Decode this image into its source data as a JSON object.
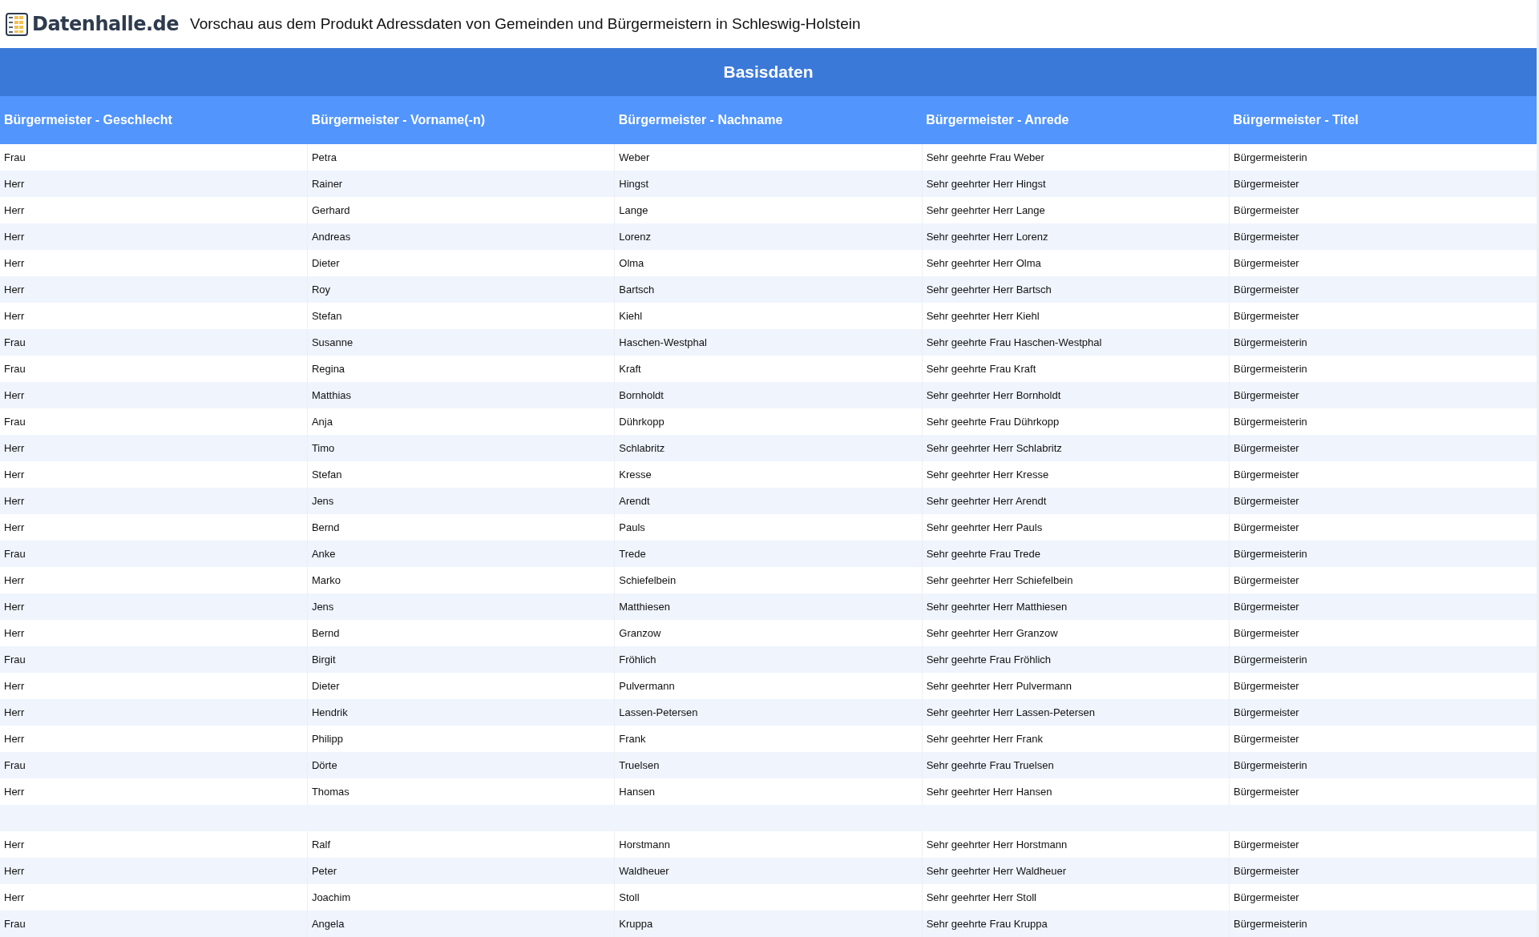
{
  "header": {
    "logo_text": "Datenhalle.de",
    "title": "Vorschau aus dem Produkt Adressdaten von Gemeinden und Bürgermeistern in Schleswig-Holstein"
  },
  "table": {
    "group_heading": "Basisdaten",
    "columns": [
      "Bürgermeister - Geschlecht",
      "Bürgermeister - Vorname(-n)",
      "Bürgermeister - Nachname",
      "Bürgermeister - Anrede",
      "Bürgermeister - Titel"
    ],
    "rows": [
      {
        "kind": "data",
        "cells": [
          "Frau",
          "Petra",
          "Weber",
          "Sehr geehrte Frau Weber",
          "Bürgermeisterin"
        ]
      },
      {
        "kind": "data",
        "cells": [
          "Herr",
          "Rainer",
          "Hingst",
          "Sehr geehrter Herr Hingst",
          "Bürgermeister"
        ]
      },
      {
        "kind": "data",
        "cells": [
          "Herr",
          "Gerhard",
          "Lange",
          "Sehr geehrter Herr Lange",
          "Bürgermeister"
        ]
      },
      {
        "kind": "data",
        "cells": [
          "Herr",
          "Andreas",
          "Lorenz",
          "Sehr geehrter Herr Lorenz",
          "Bürgermeister"
        ]
      },
      {
        "kind": "data",
        "cells": [
          "Herr",
          "Dieter",
          "Olma",
          "Sehr geehrter Herr Olma",
          "Bürgermeister"
        ]
      },
      {
        "kind": "data",
        "cells": [
          "Herr",
          "Roy",
          "Bartsch",
          "Sehr geehrter Herr Bartsch",
          "Bürgermeister"
        ]
      },
      {
        "kind": "data",
        "cells": [
          "Herr",
          "Stefan",
          "Kiehl",
          "Sehr geehrter Herr Kiehl",
          "Bürgermeister"
        ]
      },
      {
        "kind": "data",
        "cells": [
          "Frau",
          "Susanne",
          "Haschen-Westphal",
          "Sehr geehrte Frau Haschen-Westphal",
          "Bürgermeisterin"
        ]
      },
      {
        "kind": "data",
        "cells": [
          "Frau",
          "Regina",
          "Kraft",
          "Sehr geehrte Frau Kraft",
          "Bürgermeisterin"
        ]
      },
      {
        "kind": "data",
        "cells": [
          "Herr",
          "Matthias",
          "Bornholdt",
          "Sehr geehrter Herr Bornholdt",
          "Bürgermeister"
        ]
      },
      {
        "kind": "data",
        "cells": [
          "Frau",
          "Anja",
          "Dührkopp",
          "Sehr geehrte Frau Dührkopp",
          "Bürgermeisterin"
        ]
      },
      {
        "kind": "data",
        "cells": [
          "Herr",
          "Timo",
          "Schlabritz",
          "Sehr geehrter Herr Schlabritz",
          "Bürgermeister"
        ]
      },
      {
        "kind": "data",
        "cells": [
          "Herr",
          "Stefan",
          "Kresse",
          "Sehr geehrter Herr Kresse",
          "Bürgermeister"
        ]
      },
      {
        "kind": "data",
        "cells": [
          "Herr",
          "Jens",
          "Arendt",
          "Sehr geehrter Herr Arendt",
          "Bürgermeister"
        ]
      },
      {
        "kind": "data",
        "cells": [
          "Herr",
          "Bernd",
          "Pauls",
          "Sehr geehrter Herr Pauls",
          "Bürgermeister"
        ]
      },
      {
        "kind": "data",
        "cells": [
          "Frau",
          "Anke",
          "Trede",
          "Sehr geehrte Frau Trede",
          "Bürgermeisterin"
        ]
      },
      {
        "kind": "data",
        "cells": [
          "Herr",
          "Marko",
          "Schiefelbein",
          "Sehr geehrter Herr Schiefelbein",
          "Bürgermeister"
        ]
      },
      {
        "kind": "data",
        "cells": [
          "Herr",
          "Jens",
          "Matthiesen",
          "Sehr geehrter Herr Matthiesen",
          "Bürgermeister"
        ]
      },
      {
        "kind": "data",
        "cells": [
          "Herr",
          "Bernd",
          "Granzow",
          "Sehr geehrter Herr Granzow",
          "Bürgermeister"
        ]
      },
      {
        "kind": "data",
        "cells": [
          "Frau",
          "Birgit",
          "Fröhlich",
          "Sehr geehrte Frau Fröhlich",
          "Bürgermeisterin"
        ]
      },
      {
        "kind": "data",
        "cells": [
          "Herr",
          "Dieter",
          "Pulvermann",
          "Sehr geehrter Herr Pulvermann",
          "Bürgermeister"
        ]
      },
      {
        "kind": "data",
        "cells": [
          "Herr",
          "Hendrik",
          "Lassen-Petersen",
          "Sehr geehrter Herr Lassen-Petersen",
          "Bürgermeister"
        ]
      },
      {
        "kind": "data",
        "cells": [
          "Herr",
          "Philipp",
          "Frank",
          "Sehr geehrter Herr Frank",
          "Bürgermeister"
        ]
      },
      {
        "kind": "data",
        "cells": [
          "Frau",
          "Dörte",
          "Truelsen",
          "Sehr geehrte Frau Truelsen",
          "Bürgermeisterin"
        ]
      },
      {
        "kind": "data",
        "cells": [
          "Herr",
          "Thomas",
          "Hansen",
          "Sehr geehrter Herr Hansen",
          "Bürgermeister"
        ]
      },
      {
        "kind": "blank"
      },
      {
        "kind": "data",
        "cells": [
          "Herr",
          "Ralf",
          "Horstmann",
          "Sehr geehrter Herr Horstmann",
          "Bürgermeister"
        ]
      },
      {
        "kind": "data",
        "cells": [
          "Herr",
          "Peter",
          "Waldheuer",
          "Sehr geehrter Herr Waldheuer",
          "Bürgermeister"
        ]
      },
      {
        "kind": "data",
        "cells": [
          "Herr",
          "Joachim",
          "Stoll",
          "Sehr geehrter Herr Stoll",
          "Bürgermeister"
        ]
      },
      {
        "kind": "data",
        "cells": [
          "Frau",
          "Angela",
          "Kruppa",
          "Sehr geehrte Frau Kruppa",
          "Bürgermeisterin"
        ]
      }
    ]
  }
}
